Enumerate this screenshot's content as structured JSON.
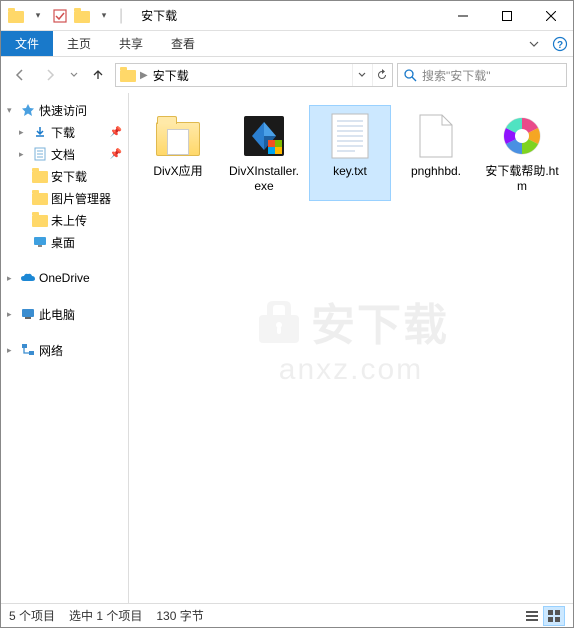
{
  "titlebar": {
    "title": "安下载"
  },
  "ribbon": {
    "file": "文件",
    "home": "主页",
    "share": "共享",
    "view": "查看"
  },
  "address": {
    "folder": "安下载"
  },
  "search": {
    "placeholder": "搜索\"安下载\""
  },
  "sidebar": {
    "quick_access": "快速访问",
    "downloads": "下载",
    "documents": "文档",
    "anxz": "安下载",
    "pic_manager": "图片管理器",
    "not_uploaded": "未上传",
    "desktop": "桌面",
    "onedrive": "OneDrive",
    "this_pc": "此电脑",
    "network": "网络"
  },
  "files": [
    {
      "name": "DivX应用",
      "type": "folder"
    },
    {
      "name": "DivXInstaller.exe",
      "type": "exe"
    },
    {
      "name": "key.txt",
      "type": "txt",
      "selected": true
    },
    {
      "name": "pnghhbd.",
      "type": "blank"
    },
    {
      "name": "安下载帮助.htm",
      "type": "htm"
    }
  ],
  "status": {
    "count": "5 个项目",
    "selection": "选中 1 个项目",
    "size": "130 字节"
  },
  "watermark": {
    "line1": "安下载",
    "line2": "anxz.com"
  }
}
